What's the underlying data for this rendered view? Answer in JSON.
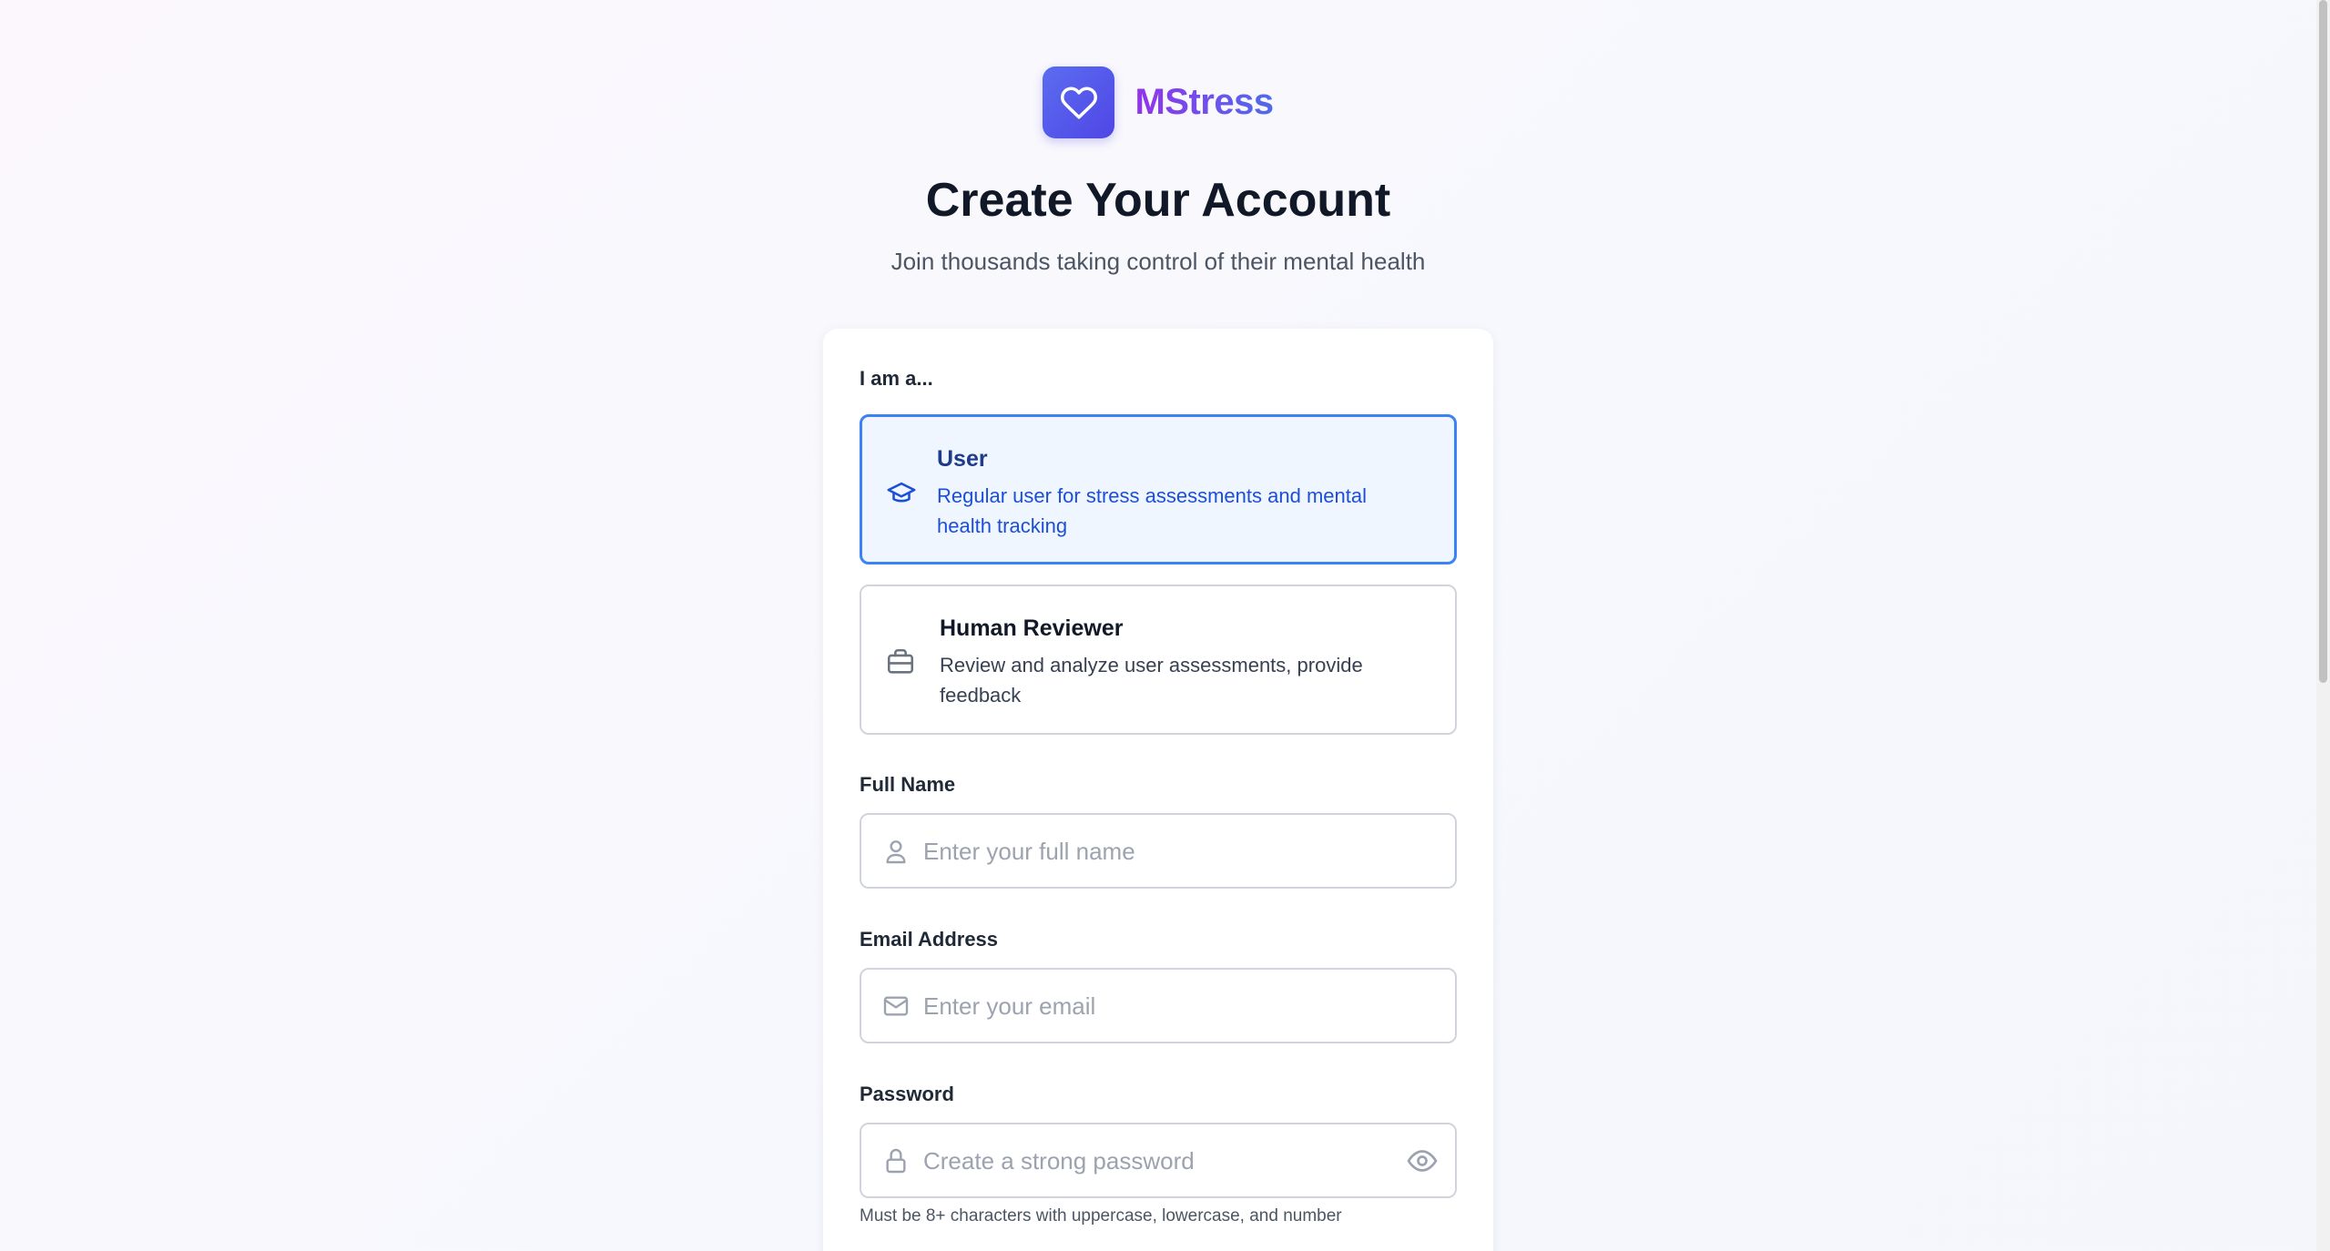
{
  "brand": {
    "name": "MStress",
    "logo_icon": "heart-icon",
    "accent": "#4f46e5"
  },
  "header": {
    "title": "Create Your Account",
    "subtitle": "Join thousands taking control of their mental health"
  },
  "form": {
    "role_label": "I am a...",
    "roles": [
      {
        "title": "User",
        "description": "Regular user for stress assessments and mental health tracking",
        "icon": "graduation-cap-icon",
        "selected": true
      },
      {
        "title": "Human Reviewer",
        "description": "Review and analyze user assessments, provide feedback",
        "icon": "briefcase-icon",
        "selected": false
      }
    ],
    "full_name": {
      "label": "Full Name",
      "placeholder": "Enter your full name",
      "value": "",
      "icon": "user-icon"
    },
    "email": {
      "label": "Email Address",
      "placeholder": "Enter your email",
      "value": "",
      "icon": "mail-icon"
    },
    "password": {
      "label": "Password",
      "placeholder": "Create a strong password",
      "value": "",
      "icon": "lock-icon",
      "toggle_icon": "eye-icon",
      "hint": "Must be 8+ characters with uppercase, lowercase, and number"
    }
  },
  "colors": {
    "selected_border": "#3b82f6",
    "selected_bg": "#eff6ff",
    "selected_text": "#1d4ed8"
  }
}
